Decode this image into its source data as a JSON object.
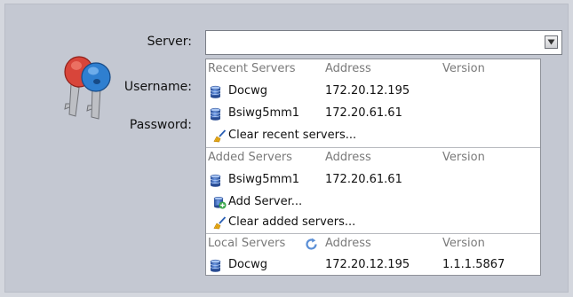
{
  "form": {
    "server_label": "Server:",
    "username_label": "Username:",
    "password_label": "Password:",
    "server_value": ""
  },
  "dropdown": {
    "recent": {
      "headers": [
        "Recent Servers",
        "Address",
        "Version"
      ],
      "items": [
        {
          "name": "Docwg",
          "address": "172.20.12.195",
          "version": ""
        },
        {
          "name": "Bsiwg5mm1",
          "address": "172.20.61.61",
          "version": ""
        }
      ],
      "action": "Clear recent servers..."
    },
    "added": {
      "headers": [
        "Added Servers",
        "Address",
        "Version"
      ],
      "items": [
        {
          "name": "Bsiwg5mm1",
          "address": "172.20.61.61",
          "version": ""
        }
      ],
      "add_action": "Add Server...",
      "clear_action": "Clear added servers..."
    },
    "local": {
      "headers": [
        "Local Servers",
        "Address",
        "Version"
      ],
      "items": [
        {
          "name": "Docwg",
          "address": "172.20.12.195",
          "version": "1.1.1.5867"
        }
      ]
    }
  },
  "icons": {
    "keys": "keys-icon",
    "server": "database-icon",
    "clear": "broom-icon",
    "add": "add-server-icon",
    "refresh": "refresh-icon",
    "dropdown": "chevron-down-icon"
  },
  "colors": {
    "background": "#c4c8d2",
    "header_text": "#7a7a7a",
    "key_red": "#d8453a",
    "key_blue": "#2f7fd0",
    "db_blue": "#3b6fc4"
  }
}
